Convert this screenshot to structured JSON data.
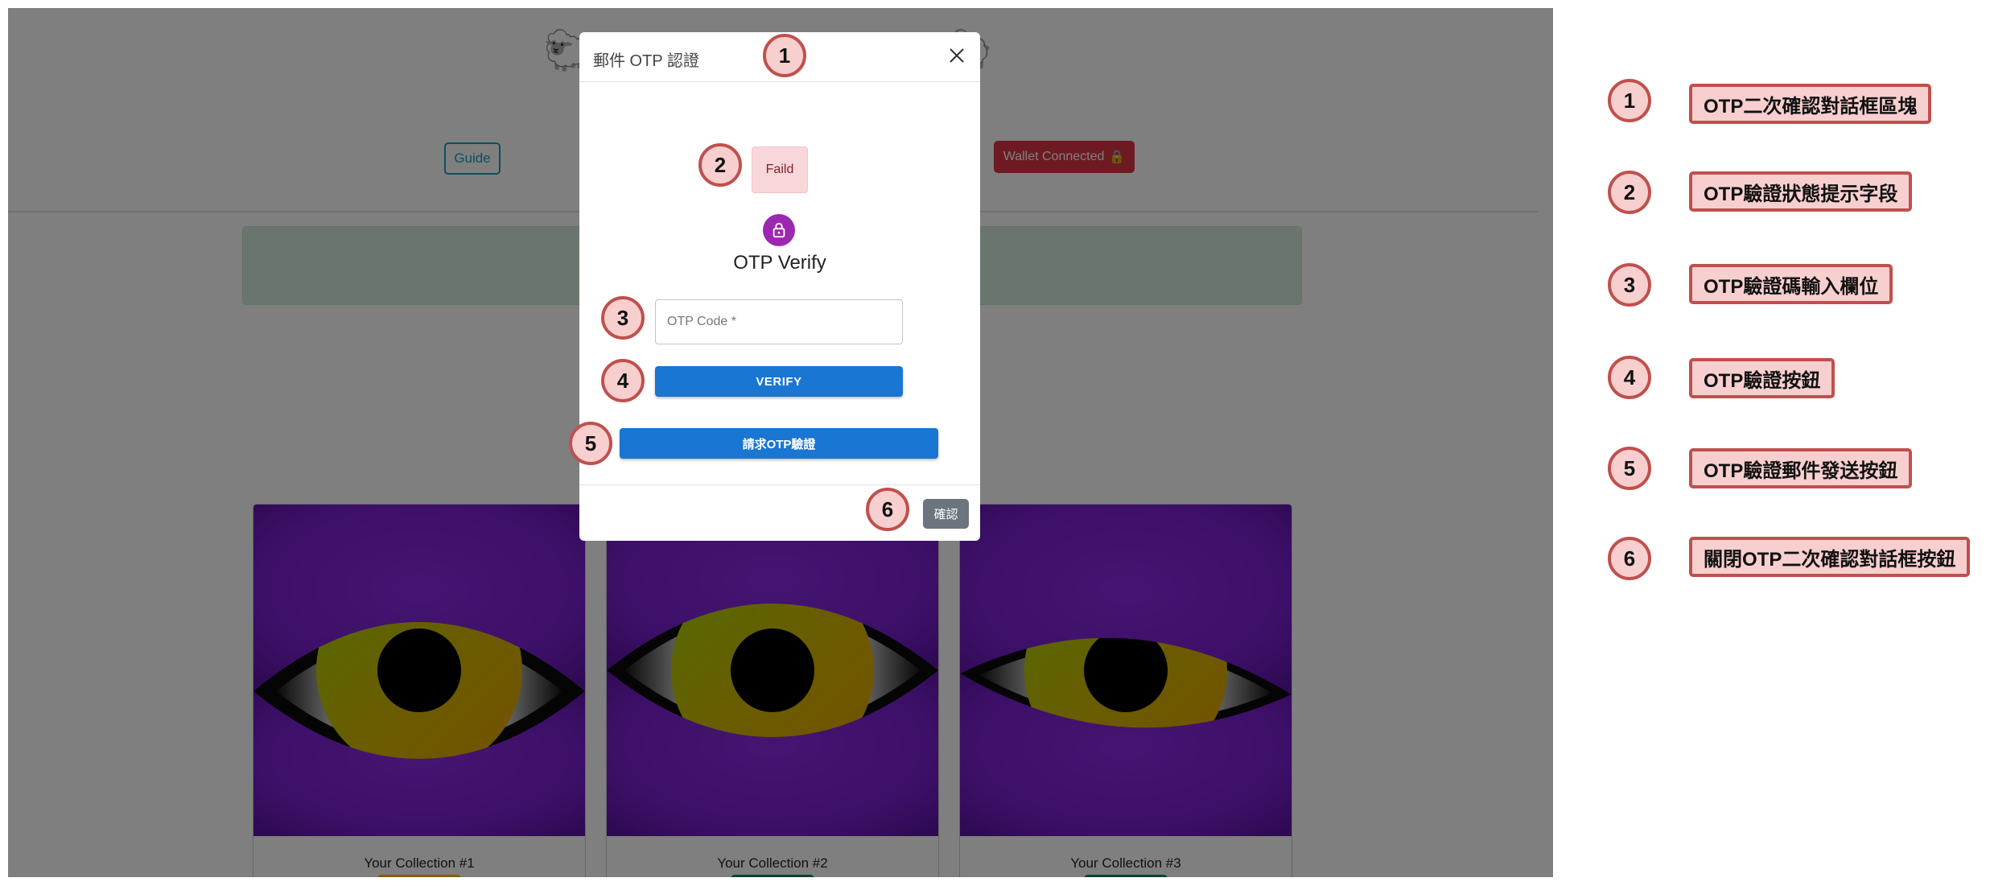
{
  "modal": {
    "title": "郵件 OTP 認證",
    "status_text": "Faild",
    "verify_title": "OTP Verify",
    "otp_placeholder": "OTP Code *",
    "verify_label": "VERIFY",
    "request_label": "請求OTP驗證",
    "confirm_label": "確認"
  },
  "background": {
    "guide_label": "Guide",
    "wallet_label": "Wallet Connected",
    "wallet_icon": "lock-icon",
    "cards": [
      {
        "title": "Your Collection #1",
        "badge_color": "#ffc107"
      },
      {
        "title": "Your Collection #2",
        "badge_color": "#198754"
      },
      {
        "title": "Your Collection #3",
        "badge_color": "#198754"
      }
    ]
  },
  "markers": [
    "1",
    "2",
    "3",
    "4",
    "5",
    "6"
  ],
  "legend": [
    {
      "number": "1",
      "label": "OTP二次確認對話框區塊"
    },
    {
      "number": "2",
      "label": "OTP驗證狀態提示字段"
    },
    {
      "number": "3",
      "label": "OTP驗證碼輸入欄位"
    },
    {
      "number": "4",
      "label": "OTP驗證按鈕"
    },
    {
      "number": "5",
      "label": "OTP驗證郵件發送按鈕"
    },
    {
      "number": "6",
      "label": "關閉OTP二次確認對話框按鈕"
    }
  ],
  "colors": {
    "marker_fill": "#f8cfcf",
    "marker_border": "#c0504d",
    "primary": "#1976d2",
    "danger": "#dc3545",
    "info": "#17a2b8",
    "secondary": "#6c757d",
    "avatar": "#9c27b0",
    "eye_background": "#7a1fd0"
  }
}
